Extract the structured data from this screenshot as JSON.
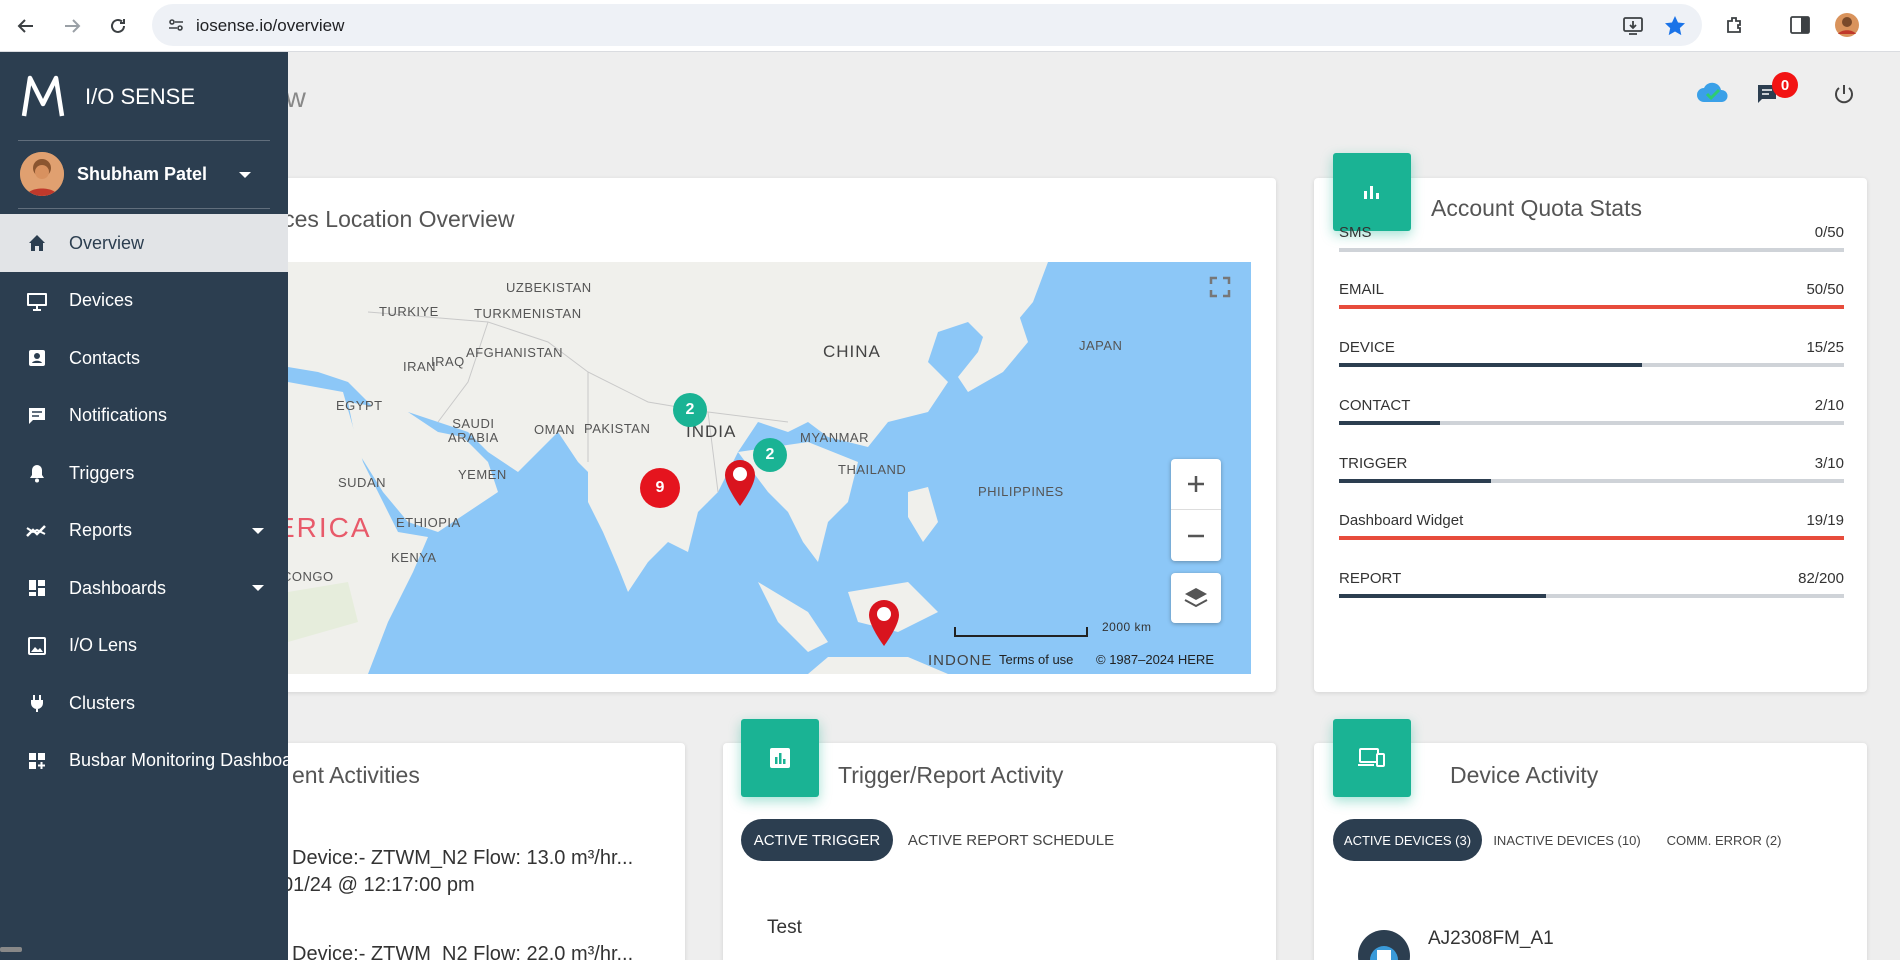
{
  "browser": {
    "url": "iosense.io/overview"
  },
  "header": {
    "page_title_partial": "ew",
    "notification_count": "0"
  },
  "sidebar": {
    "brand": "I/O SENSE",
    "user_name": "Shubham Patel",
    "items": [
      {
        "label": "Overview",
        "icon": "home-icon",
        "active": true
      },
      {
        "label": "Devices",
        "icon": "monitor-icon"
      },
      {
        "label": "Contacts",
        "icon": "contact-card-icon"
      },
      {
        "label": "Notifications",
        "icon": "message-icon"
      },
      {
        "label": "Triggers",
        "icon": "bell-icon"
      },
      {
        "label": "Reports",
        "icon": "trend-icon",
        "expandable": true
      },
      {
        "label": "Dashboards",
        "icon": "dashboard-icon",
        "expandable": true
      },
      {
        "label": "I/O Lens",
        "icon": "image-icon"
      },
      {
        "label": "Clusters",
        "icon": "plug-icon"
      },
      {
        "label": "Busbar Monitoring Dashboa",
        "icon": "add-dashboard-icon"
      }
    ]
  },
  "map_card": {
    "title_partial": "ices Location Overview",
    "labels": {
      "uzbekistan": "UZBEKISTAN",
      "turkmenistan": "TURKMENISTAN",
      "turkiye": "TURKIYE",
      "afghanistan": "AFGHANISTAN",
      "iraq": "IRAQ",
      "iran": "IRAN",
      "china": "CHINA",
      "japan": "JAPAN",
      "pakistan": "PAKISTAN",
      "egypt": "EGYPT",
      "india": "INDIA",
      "myanmar": "MYANMAR",
      "saudi": "SAUDI\nARABIA",
      "oman": "OMAN",
      "yemen": "YEMEN",
      "thailand": "THAILAND",
      "philippines": "PHILIPPINES",
      "sudan": "SUDAN",
      "africa_partial": "ERICA",
      "ethiopia": "ETHIOPIA",
      "kenya": "KENYA",
      "congo_partial": "R CONGO",
      "indonesia_partial": "INDONE"
    },
    "clusters": [
      {
        "count": "2",
        "color": "#1ab394"
      },
      {
        "count": "2",
        "color": "#1ab394"
      },
      {
        "count": "9",
        "color": "#e5141e"
      }
    ],
    "scale_label": "2000 km",
    "terms": "Terms of use",
    "copyright": "© 1987–2024 HERE"
  },
  "quota_card": {
    "title": "Account Quota Stats",
    "rows": [
      {
        "label": "SMS",
        "value": "0/50",
        "fraction": 0.0,
        "color": "#2c3e50"
      },
      {
        "label": "EMAIL",
        "value": "50/50",
        "fraction": 1.0,
        "color": "#e74c3c"
      },
      {
        "label": "DEVICE",
        "value": "15/25",
        "fraction": 0.6,
        "color": "#2c3e50"
      },
      {
        "label": "CONTACT",
        "value": "2/10",
        "fraction": 0.2,
        "color": "#2c3e50"
      },
      {
        "label": "TRIGGER",
        "value": "3/10",
        "fraction": 0.3,
        "color": "#2c3e50"
      },
      {
        "label": "Dashboard Widget",
        "value": "19/19",
        "fraction": 1.0,
        "color": "#e74c3c"
      },
      {
        "label": "REPORT",
        "value": "82/200",
        "fraction": 0.41,
        "color": "#2c3e50"
      }
    ]
  },
  "recent_card": {
    "title_partial": "ent Activities",
    "line1": "Device:- ZTWM_N2 Flow: 13.0 m³/hr...",
    "line2": "01/24 @ 12:17:00 pm",
    "line3": "Device:- ZTWM_N2 Flow: 22.0 m³/hr..."
  },
  "trigger_card": {
    "title": "Trigger/Report Activity",
    "tab_active": "ACTIVE TRIGGER",
    "tab_other": "ACTIVE REPORT SCHEDULE",
    "first_item": "Test"
  },
  "device_card": {
    "title": "Device Activity",
    "tab_active": "ACTIVE DEVICES (3)",
    "tab_inactive": "INACTIVE DEVICES (10)",
    "tab_error": "COMM. ERROR (2)",
    "first_device": "AJ2308FM_A1"
  },
  "colors": {
    "sidebar": "#2c3e50",
    "accent": "#1ab394",
    "danger": "#e74c3c"
  }
}
